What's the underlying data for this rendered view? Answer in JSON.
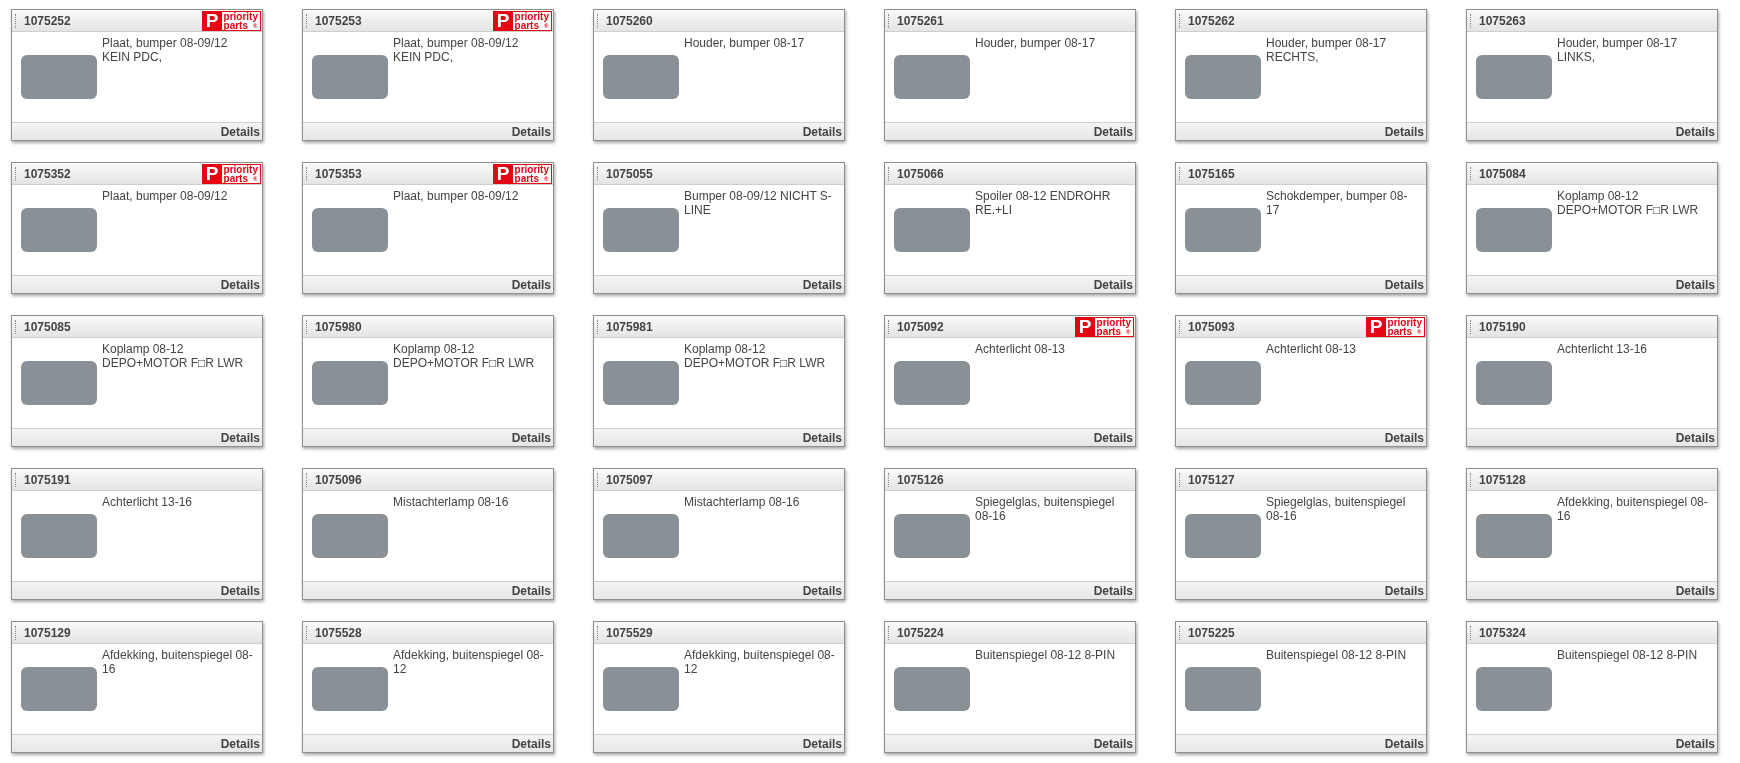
{
  "cards": [
    {
      "code": "1075252",
      "badge": {
        "letter": "P",
        "lines": [
          "priority",
          "parts"
        ],
        "mark": "®"
      },
      "description": "Plaat, bumper 08-09/12 KEIN PDC,",
      "link": "Details"
    },
    {
      "code": "1075253",
      "badge": {
        "letter": "P",
        "lines": [
          "priority",
          "parts"
        ],
        "mark": "®"
      },
      "description": "Plaat, bumper 08-09/12 KEIN PDC,",
      "link": "Details"
    },
    {
      "code": "1075260",
      "description": "Houder, bumper 08-17",
      "link": "Details"
    },
    {
      "code": "1075261",
      "description": "Houder, bumper 08-17",
      "link": "Details"
    },
    {
      "code": "1075262",
      "description": "Houder, bumper 08-17 RECHTS,",
      "link": "Details"
    },
    {
      "code": "1075263",
      "description": "Houder, bumper 08-17 LINKS,",
      "link": "Details"
    },
    {
      "code": "1075352",
      "badge": {
        "letter": "P",
        "lines": [
          "priority",
          "parts"
        ],
        "mark": "®"
      },
      "description": "Plaat, bumper 08-09/12",
      "link": "Details"
    },
    {
      "code": "1075353",
      "badge": {
        "letter": "P",
        "lines": [
          "priority",
          "parts"
        ],
        "mark": "®"
      },
      "description": "Plaat, bumper 08-09/12",
      "link": "Details"
    },
    {
      "code": "1075055",
      "description": "Bumper 08-09/12 NICHT S-LINE",
      "link": "Details"
    },
    {
      "code": "1075066",
      "description": "Spoiler 08-12 ENDROHR RE.+LI",
      "link": "Details"
    },
    {
      "code": "1075165",
      "description": "Schokdemper, bumper 08-17",
      "link": "Details"
    },
    {
      "code": "1075084",
      "description": "Koplamp 08-12 DEPO+MOTOR F□R LWR",
      "link": "Details"
    },
    {
      "code": "1075085",
      "description": "Koplamp 08-12 DEPO+MOTOR F□R LWR",
      "link": "Details"
    },
    {
      "code": "1075980",
      "description": "Koplamp 08-12 DEPO+MOTOR F□R LWR",
      "link": "Details"
    },
    {
      "code": "1075981",
      "description": "Koplamp 08-12 DEPO+MOTOR F□R LWR",
      "link": "Details"
    },
    {
      "code": "1075092",
      "badge": {
        "letter": "P",
        "lines": [
          "priority",
          "parts"
        ],
        "mark": "®"
      },
      "description": "Achterlicht 08-13",
      "link": "Details"
    },
    {
      "code": "1075093",
      "badge": {
        "letter": "P",
        "lines": [
          "priority",
          "parts"
        ],
        "mark": "®"
      },
      "description": "Achterlicht 08-13",
      "link": "Details"
    },
    {
      "code": "1075190",
      "description": "Achterlicht 13-16",
      "link": "Details"
    },
    {
      "code": "1075191",
      "description": "Achterlicht 13-16",
      "link": "Details"
    },
    {
      "code": "1075096",
      "description": "Mistachterlamp 08-16",
      "link": "Details"
    },
    {
      "code": "1075097",
      "description": "Mistachterlamp 08-16",
      "link": "Details"
    },
    {
      "code": "1075126",
      "description": "Spiegelglas, buitenspiegel 08-16",
      "link": "Details"
    },
    {
      "code": "1075127",
      "description": "Spiegelglas, buitenspiegel 08-16",
      "link": "Details"
    },
    {
      "code": "1075128",
      "description": "Afdekking, buitenspiegel 08-16",
      "link": "Details"
    },
    {
      "code": "1075129",
      "description": "Afdekking, buitenspiegel 08-16",
      "link": "Details"
    },
    {
      "code": "1075528",
      "description": "Afdekking, buitenspiegel 08-12",
      "link": "Details"
    },
    {
      "code": "1075529",
      "description": "Afdekking, buitenspiegel 08-12",
      "link": "Details"
    },
    {
      "code": "1075224",
      "description": "Buitenspiegel 08-12 8-PIN",
      "link": "Details"
    },
    {
      "code": "1075225",
      "description": "Buitenspiegel 08-12 8-PIN",
      "link": "Details"
    },
    {
      "code": "1075324",
      "description": "Buitenspiegel 08-12 8-PIN",
      "link": "Details"
    }
  ]
}
